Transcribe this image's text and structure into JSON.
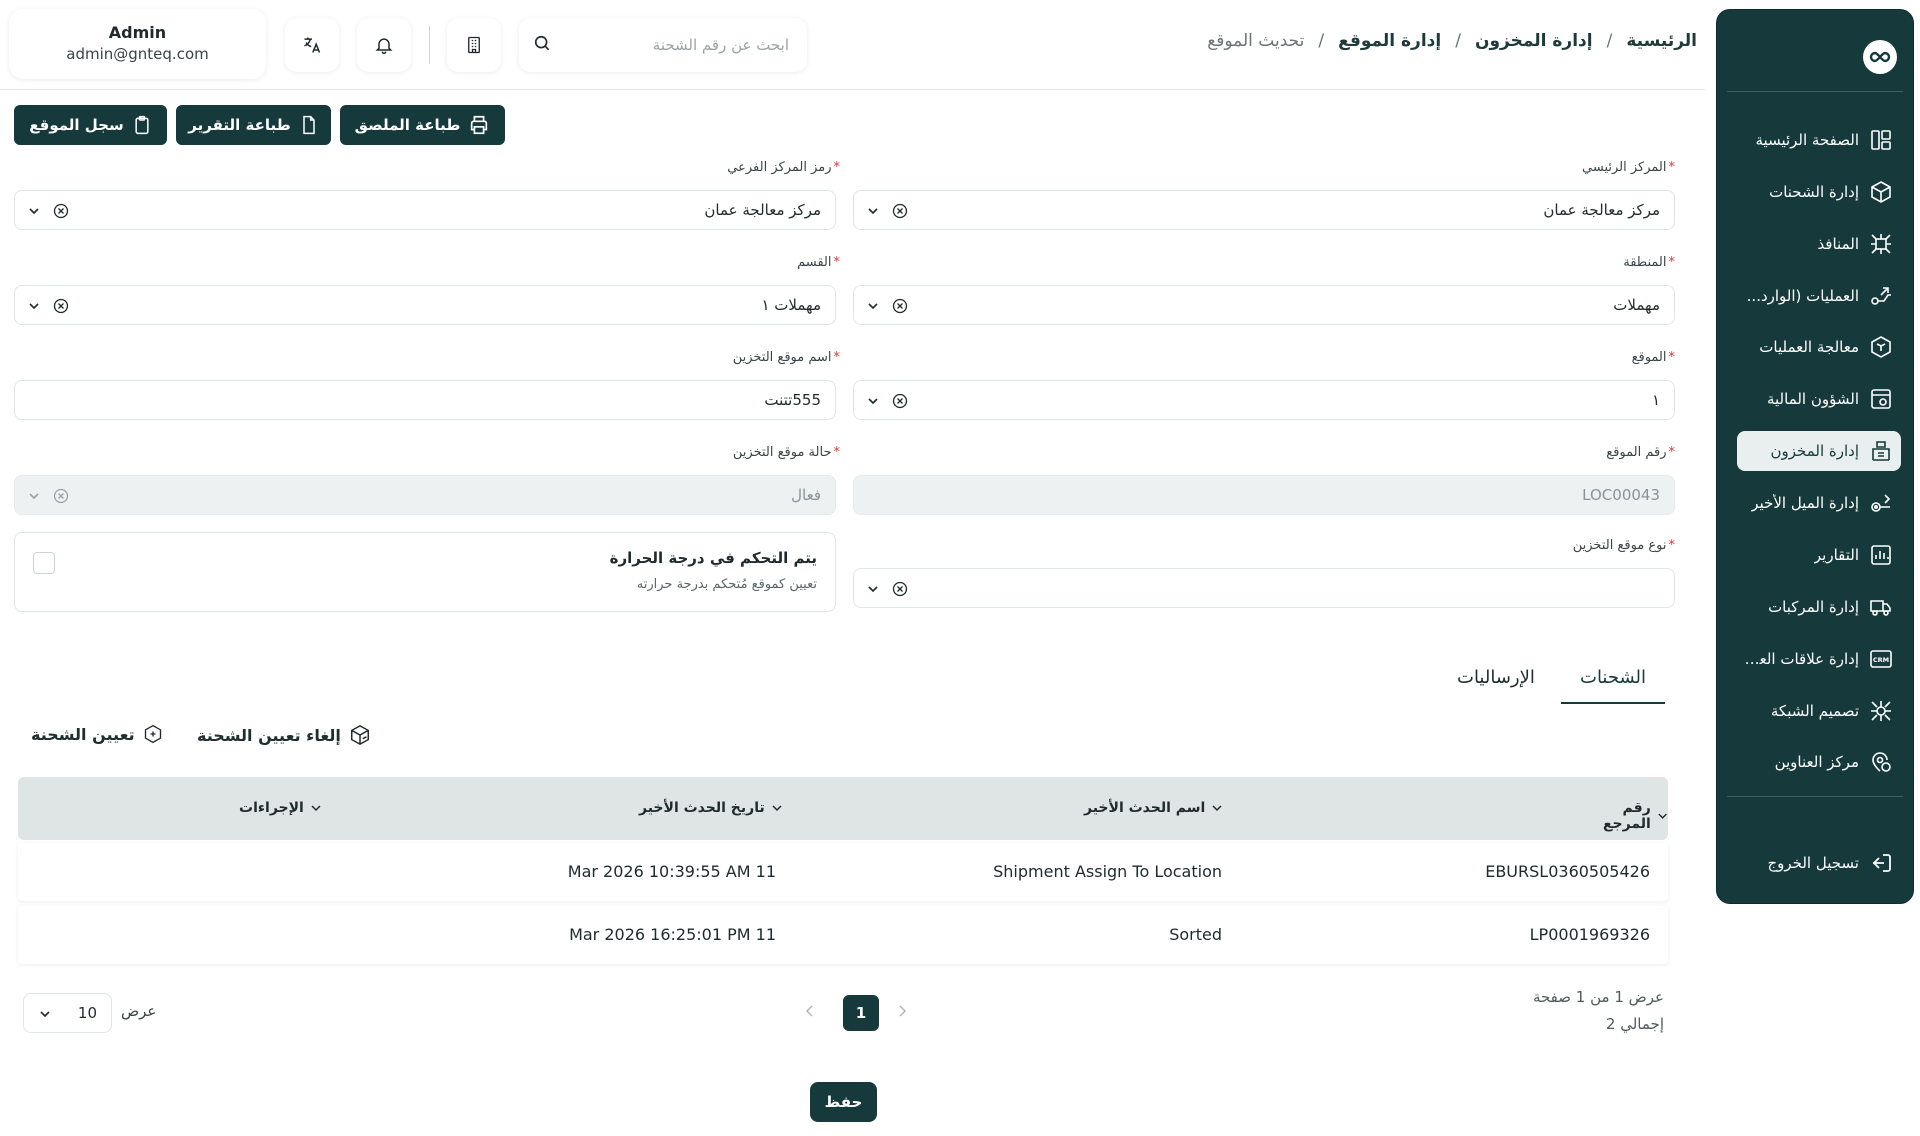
{
  "header": {
    "user_name": "Admin",
    "user_email": "admin@gnteq.com",
    "search_placeholder": "ابحث عن رقم الشحنة",
    "breadcrumbs": [
      "الرئيسية",
      "/",
      "إدارة المخزون",
      "/",
      "إدارة الموقع",
      "/",
      "تحديث الموقع"
    ]
  },
  "sidebar": {
    "items": [
      {
        "label": "الصفحة الرئيسية",
        "icon": "dashboard-icon"
      },
      {
        "label": "إدارة الشحنات",
        "icon": "package-icon"
      },
      {
        "label": "المنافذ",
        "icon": "ports-icon"
      },
      {
        "label": "العمليات (الوارد...",
        "icon": "operations-icon"
      },
      {
        "label": "معالجة العمليات",
        "icon": "box-process-icon"
      },
      {
        "label": "الشؤون المالية",
        "icon": "finance-icon"
      },
      {
        "label": "إدارة المخزون",
        "icon": "warehouse-icon"
      },
      {
        "label": "إدارة الميل الأخير",
        "icon": "last-mile-icon"
      },
      {
        "label": "التقارير",
        "icon": "reports-icon"
      },
      {
        "label": "إدارة المركبات",
        "icon": "truck-icon"
      },
      {
        "label": "إدارة علاقات العملاء",
        "icon": "crm-icon"
      },
      {
        "label": "تصميم الشبكة",
        "icon": "network-icon"
      },
      {
        "label": "مركز العناوين",
        "icon": "address-icon"
      }
    ],
    "active_index": 6,
    "logout": "تسجيل الخروج"
  },
  "actions": {
    "print_label": "طباعة الملصق",
    "print_report": "طباعة التقرير",
    "location_log": "سجل الموقع"
  },
  "form": {
    "main_center": {
      "label": "المركز الرئيسي",
      "value": "مركز معالجة عمان"
    },
    "sub_center_code": {
      "label": "رمز المركز الفرعي",
      "value": "مركز معالجة عمان"
    },
    "region": {
      "label": "المنطقة",
      "value": "مهملات"
    },
    "section": {
      "label": "القسم",
      "value": "مهملات ١"
    },
    "location": {
      "label": "الموقع",
      "value": "١"
    },
    "storage_name": {
      "label": "اسم موقع التخزين",
      "value": "555تتنت"
    },
    "location_number": {
      "label": "رقم الموقع",
      "value": "LOC00043"
    },
    "storage_status": {
      "label": "حالة موقع التخزين",
      "value": "فعال"
    },
    "storage_type": {
      "label": "نوع موقع التخزين",
      "value": ""
    },
    "temperature": {
      "title": "يتم التحكم في درجة الحرارة",
      "subtitle": "تعيين كموقع مُتحكم بدرجة حرارته",
      "checked": false
    }
  },
  "tabs": {
    "shipments": "الشحنات",
    "consignments": "الإرساليات"
  },
  "table_actions": {
    "unassign": "إلغاء تعيين الشحنة",
    "assign": "تعيين الشحنة"
  },
  "table": {
    "headers": {
      "reference": "رقم المرجع",
      "last_event": "اسم الحدث الأخير",
      "last_event_date": "تاريخ الحدث الأخير",
      "actions": "الإجراءات"
    },
    "rows": [
      {
        "reference": "EBURSL0360505426",
        "last_event": "Shipment Assign To Location",
        "date": "11 Mar 2026 10:39:55 AM"
      },
      {
        "reference": "LP0001969326",
        "last_event": "Sorted",
        "date": "11 Mar 2026 16:25:01 PM"
      }
    ]
  },
  "pagination": {
    "page_info": "عرض 1 من 1 صفحة",
    "total": "إجمالي 2",
    "current_page": "1",
    "per_page": "10",
    "per_page_label": "عرض"
  },
  "save_label": "حفظ",
  "colors": {
    "primary": "#163a3b",
    "required": "#d9342b"
  }
}
